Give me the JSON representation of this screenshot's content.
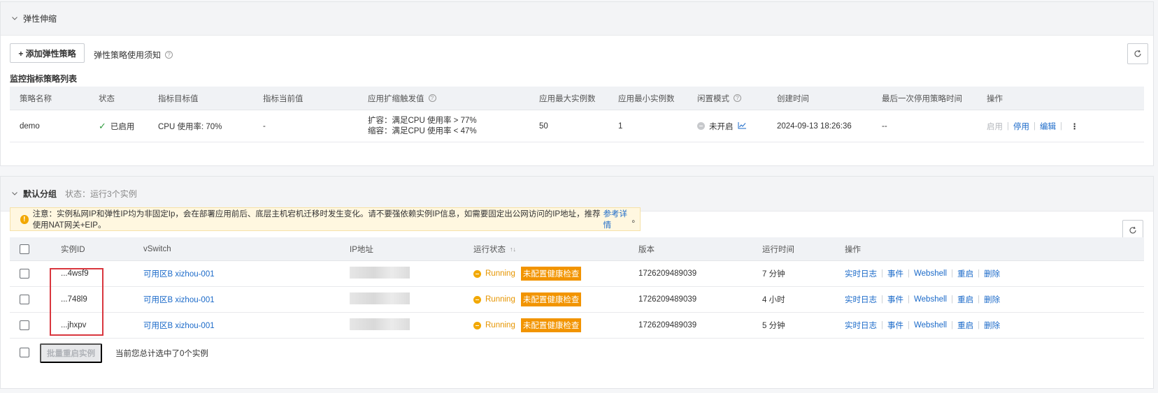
{
  "scaling": {
    "title": "弹性伸缩",
    "add_button": "+ 添加弹性策略",
    "notice_link": "弹性策略使用须知",
    "list_title": "监控指标策略列表",
    "columns": [
      "策略名称",
      "状态",
      "指标目标值",
      "指标当前值",
      "应用扩缩触发值",
      "应用最大实例数",
      "应用最小实例数",
      "闲置模式",
      "创建时间",
      "最后一次停用策略时间",
      "操作"
    ],
    "rows": [
      {
        "name": "demo",
        "status": "已启用",
        "target": "CPU 使用率: 70%",
        "current": "-",
        "trigger_up": "扩容：满足CPU 使用率 > 77%",
        "trigger_down": "缩容：满足CPU 使用率 < 47%",
        "max": "50",
        "min": "1",
        "idle": "未开启",
        "created": "2024-09-13 18:26:36",
        "last_disabled": "--",
        "actions": {
          "enable": "启用",
          "disable": "停用",
          "edit": "编辑"
        }
      }
    ]
  },
  "group": {
    "title": "默认分组",
    "status": "状态：运行3个实例",
    "warning_text": "注意：实例私网IP和弹性IP均为非固定Ip，会在部署应用前后、底层主机宕机迁移时发生变化。请不要强依赖实例IP信息，如需要固定出公网访问的IP地址，推荐使用NAT网关+EIP。",
    "warning_link": "参考详情",
    "warning_end": "。",
    "columns": [
      "实例ID",
      "vSwitch",
      "IP地址",
      "运行状态",
      "版本",
      "运行时间",
      "操作"
    ],
    "instances": [
      {
        "id": "...4wsf9",
        "vswitch": "可用区B xizhou-001",
        "state": "Running",
        "health": "未配置健康检查",
        "version": "1726209489039",
        "uptime": "7 分钟"
      },
      {
        "id": "...748l9",
        "vswitch": "可用区B xizhou-001",
        "state": "Running",
        "health": "未配置健康检查",
        "version": "1726209489039",
        "uptime": "4 小时"
      },
      {
        "id": "...jhxpv",
        "vswitch": "可用区B xizhou-001",
        "state": "Running",
        "health": "未配置健康检查",
        "version": "1726209489039",
        "uptime": "5 分钟"
      }
    ],
    "instance_actions": [
      "实时日志",
      "事件",
      "Webshell",
      "重启",
      "删除"
    ],
    "batch_button": "批量重启实例",
    "selected_info": "当前您总计选中了0个实例"
  },
  "colors": {
    "link": "#1b6ac9",
    "running": "#e69500",
    "health_tag": "#f29400",
    "enabled": "#2e9b3d",
    "highlight_box": "#d9363e"
  },
  "icons": [
    "chevron-down-icon",
    "question-icon",
    "refresh-icon",
    "check-icon",
    "line-chart-icon",
    "more-icon",
    "warning-icon",
    "sort-icon"
  ]
}
